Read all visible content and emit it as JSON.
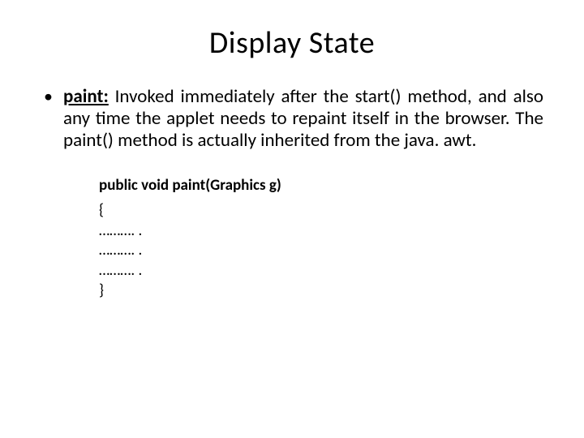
{
  "title": "Display State",
  "bullet": {
    "term": "paint:",
    "description": " Invoked immediately after the start() method, and also any time the applet needs to repaint itself in the browser. The paint() method is actually inherited from the java. awt."
  },
  "code": {
    "signature": "public void paint(Graphics g)",
    "lines": [
      "{",
      "………. .",
      "………. .",
      "………. .",
      "}"
    ]
  }
}
